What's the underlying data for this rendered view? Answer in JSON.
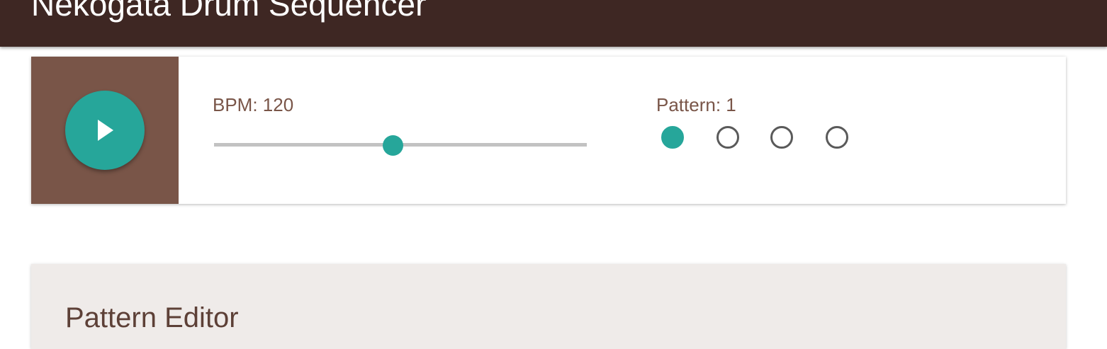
{
  "app": {
    "title": "Nekogata Drum Sequencer"
  },
  "transport": {
    "play_icon": "play-icon",
    "bpm_label": "BPM: 120",
    "bpm_value": 120,
    "bpm_slider_fraction": 0.48
  },
  "pattern": {
    "label": "Pattern: 1",
    "selected": 1,
    "options": [
      1,
      2,
      3,
      4
    ]
  },
  "editor": {
    "title": "Pattern Editor"
  },
  "colors": {
    "appbar": "#3e2723",
    "brown": "#795548",
    "accent": "#26a69a",
    "editor_bg": "#efebe9"
  }
}
